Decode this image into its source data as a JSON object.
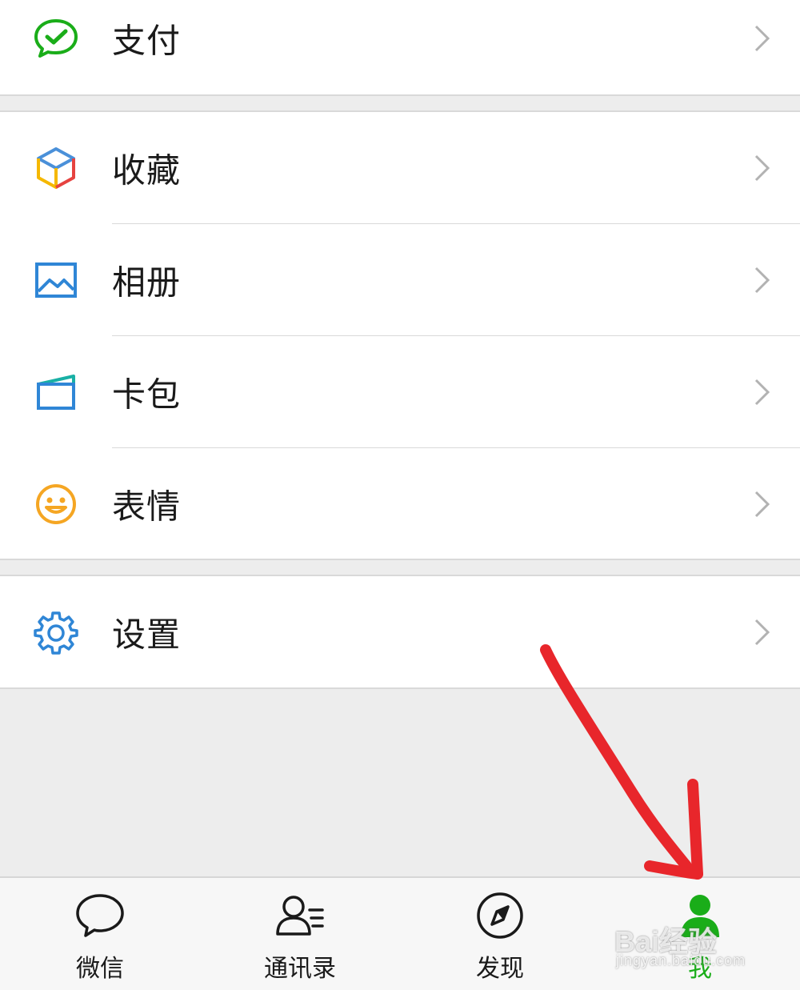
{
  "menu": {
    "pay_label": "支付",
    "favorites_label": "收藏",
    "album_label": "相册",
    "cards_label": "卡包",
    "stickers_label": "表情",
    "settings_label": "设置"
  },
  "tabbar": {
    "tabs": [
      {
        "label": "微信",
        "icon": "chat-bubble-icon"
      },
      {
        "label": "通讯录",
        "icon": "contacts-icon"
      },
      {
        "label": "发现",
        "icon": "compass-icon"
      },
      {
        "label": "我",
        "icon": "person-icon"
      }
    ],
    "active_index": 3
  },
  "watermark": {
    "logo": "Bai经验",
    "url": "jingyan.baidu.com"
  },
  "colors": {
    "accent_green": "#1aad19",
    "annotation_red": "#e8262b",
    "background": "#ededed"
  }
}
